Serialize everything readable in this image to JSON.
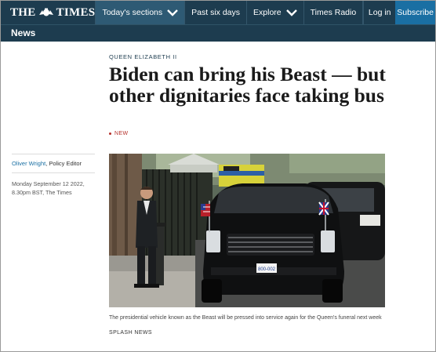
{
  "header": {
    "logo_left": "THE",
    "logo_right": "TIMES",
    "nav": [
      {
        "label": "Today's sections",
        "has_dropdown": true
      },
      {
        "label": "Past six days",
        "has_dropdown": false
      },
      {
        "label": "Explore",
        "has_dropdown": true
      },
      {
        "label": "Times Radio",
        "has_dropdown": false
      }
    ],
    "login_label": "Log in",
    "subscribe_label": "Subscribe"
  },
  "section": {
    "title": "News"
  },
  "article": {
    "kicker": "QUEEN ELIZABETH II",
    "headline": "Biden can bring his Beast — but other dignitaries face taking bus",
    "new_tag": "NEW",
    "author": "Oliver Wright",
    "author_role": ", Policy Editor",
    "date_line_1": "Monday September 12 2022,",
    "date_line_2": "8.30pm BST, The Times",
    "image": {
      "plate_text": "800-002",
      "alt_icon": "presidential-limousine-photo"
    },
    "caption": "The presidential vehicle known as the Beast will be pressed into service again for the Queen's funeral next week",
    "credit": "SPLASH NEWS"
  },
  "colors": {
    "nav_bg": "#1d3c4f",
    "subscribe_bg": "#1a6fa3",
    "accent_red": "#b5302a",
    "link_blue": "#1a6fa3"
  }
}
